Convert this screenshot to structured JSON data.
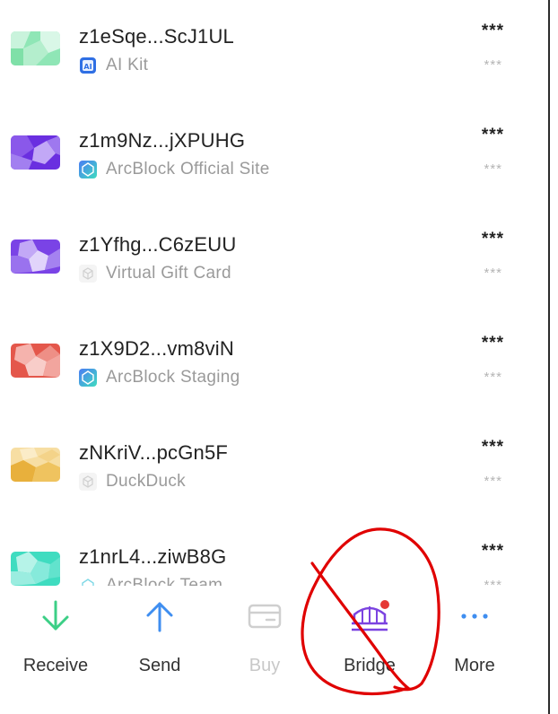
{
  "assets": [
    {
      "address": "z1eSqe...ScJ1UL",
      "app": "AI Kit",
      "app_icon": "ai-kit-icon",
      "balance": "***",
      "fiat": "***",
      "colors": [
        "#7fe0a8",
        "#c9f3dc"
      ]
    },
    {
      "address": "z1m9Nz...jXPUHG",
      "app": "ArcBlock Official Site",
      "app_icon": "arcblock-icon",
      "balance": "***",
      "fiat": "***",
      "colors": [
        "#6a2fe0",
        "#b89af5"
      ]
    },
    {
      "address": "z1Yfhg...C6zEUU",
      "app": "Virtual Gift Card",
      "app_icon": "cube-icon",
      "balance": "***",
      "fiat": "***",
      "colors": [
        "#7a43e6",
        "#c2a8f6"
      ]
    },
    {
      "address": "z1X9D2...vm8viN",
      "app": "ArcBlock Staging",
      "app_icon": "arcblock-icon",
      "balance": "***",
      "fiat": "***",
      "colors": [
        "#e4574b",
        "#f5b3ad"
      ]
    },
    {
      "address": "zNKriV...pcGn5F",
      "app": "DuckDuck",
      "app_icon": "cube-icon",
      "balance": "***",
      "fiat": "***",
      "colors": [
        "#e8b03c",
        "#f7deA3"
      ]
    },
    {
      "address": "z1nrL4...ziwB8G",
      "app": "ArcBlock Team",
      "app_icon": "arcblock-icon",
      "balance": "***",
      "fiat": "***",
      "colors": [
        "#3fdcc0",
        "#b6f3e8"
      ]
    }
  ],
  "actions": [
    {
      "label": "Receive",
      "icon": "arrow-down-icon",
      "color": "#3ccf86"
    },
    {
      "label": "Send",
      "icon": "arrow-up-icon",
      "color": "#3f8ef0"
    },
    {
      "label": "Buy",
      "icon": "card-icon",
      "color": "#cfcfcf"
    },
    {
      "label": "Bridge",
      "icon": "bridge-icon",
      "color": "#7b43e0",
      "badge": "#e53935"
    },
    {
      "label": "More",
      "icon": "more-icon",
      "color": "#3f8ef0"
    }
  ],
  "annotation": {
    "type": "red-hand-drawn-circle-with-slash",
    "color": "#e00000"
  }
}
